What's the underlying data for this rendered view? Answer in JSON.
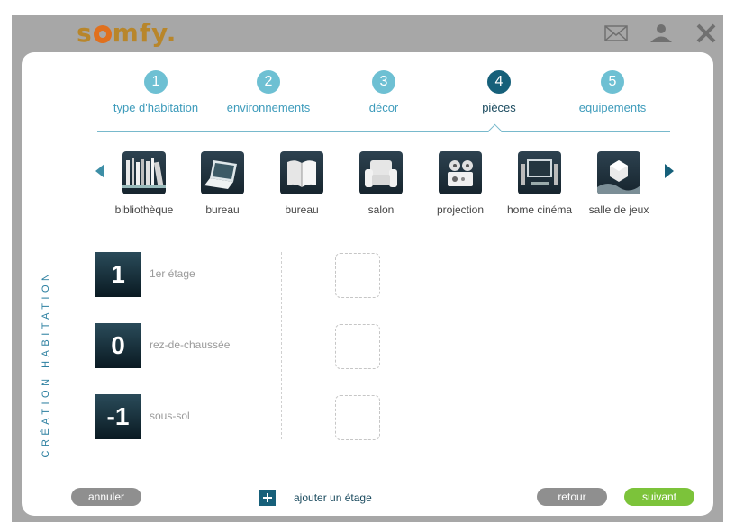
{
  "brand": {
    "logo_text_before": "s",
    "logo_text_after": "mfy."
  },
  "steps": [
    {
      "number": "1",
      "label": "type d'habitation",
      "active": false
    },
    {
      "number": "2",
      "label": "environnements",
      "active": false
    },
    {
      "number": "3",
      "label": "décor",
      "active": false
    },
    {
      "number": "4",
      "label": "pièces",
      "active": true
    },
    {
      "number": "5",
      "label": "equipements",
      "active": false
    }
  ],
  "rooms": [
    {
      "label": "bibliothèque",
      "icon": "bookshelf-icon"
    },
    {
      "label": "bureau",
      "icon": "laptop-icon"
    },
    {
      "label": "bureau",
      "icon": "book-icon"
    },
    {
      "label": "salon",
      "icon": "armchair-icon"
    },
    {
      "label": "projection",
      "icon": "projector-icon"
    },
    {
      "label": "home cinéma",
      "icon": "tv-icon"
    },
    {
      "label": "salle de jeux",
      "icon": "game-icon"
    }
  ],
  "sidebar": {
    "vertical_title": "CRÉATION HABITATION"
  },
  "floors": [
    {
      "number": "1",
      "label": "1er étage"
    },
    {
      "number": "0",
      "label": "rez-de-chaussée"
    },
    {
      "number": "-1",
      "label": "sous-sol"
    }
  ],
  "footer": {
    "cancel_label": "annuler",
    "add_floor_label": "ajouter un étage",
    "back_label": "retour",
    "next_label": "suivant"
  },
  "icons": {
    "mail": "mail-icon",
    "user": "user-icon",
    "close": "close-icon",
    "plus": "plus-icon"
  },
  "colors": {
    "accent": "#16607a",
    "step_inactive": "#6ec0d3",
    "next_button": "#7cc33a",
    "logo": "#b8862b"
  }
}
